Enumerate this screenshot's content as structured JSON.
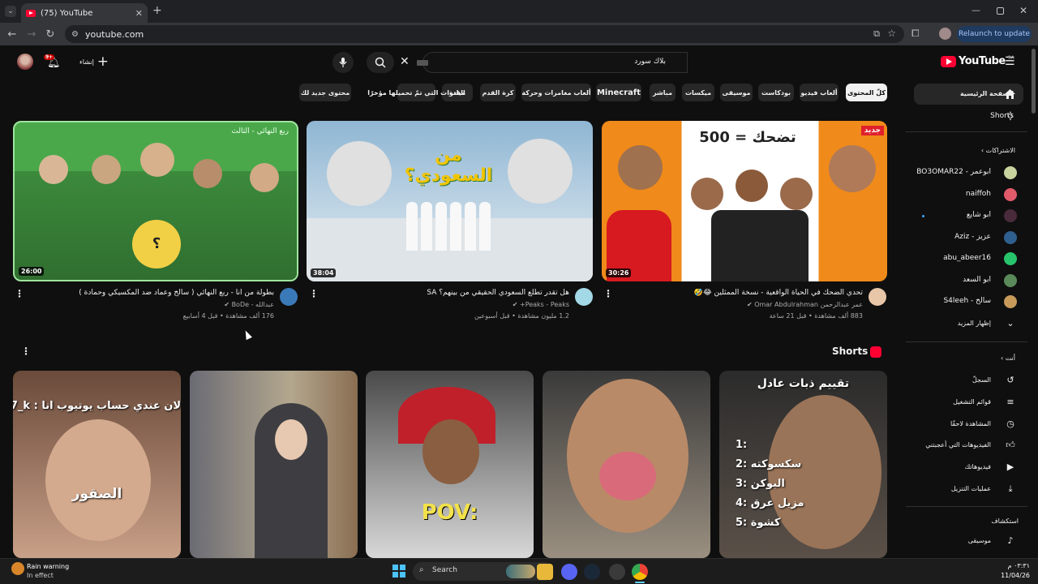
{
  "browser": {
    "tab_title": "(75) YouTube",
    "url": "youtube.com",
    "relaunch_label": "Relaunch to update"
  },
  "header": {
    "logo_text": "YouTube",
    "logo_region": "SA",
    "search_value": "بلاك سورد",
    "create_label": "إنشاء",
    "notif_count": "9+"
  },
  "chips": [
    "كلّ المحتوى",
    "ألعاب فيديو",
    "بودكاست",
    "موسيقى",
    "ميكسات",
    "مباشر",
    "Minecraft",
    "ألعاب مغامرات وحركة",
    "كرة القدم",
    "ميادة",
    "القنوات التي تمّ تحميلها مؤخرًا",
    "محتوى جديد لك"
  ],
  "videos": [
    {
      "title": "بطولة من انا - ربع النهائي ( سالخ وعماد ضد المكسيكي وحمادة )",
      "channel": "عبدالله - BoDe",
      "meta": "176 ألف مشاهدة • قبل 4 أسابيع",
      "duration": "26:00",
      "overlay": "ربع النهائي - الثالث"
    },
    {
      "title": "هل تقدر تطلع السعودي الحقيقي من بينهم؟ SA",
      "channel": "Peaks - Peaks+",
      "meta": "1.2 مليون مشاهدة • قبل أسبوعين",
      "duration": "38:04",
      "overlay": "من السعودي؟"
    },
    {
      "title": "تحدي الضحك في الحياة الواقعية - نسخة الممثلين 😂🤣",
      "channel": "عمر عبدالرحمن Omar Abdulrahman",
      "meta": "883 ألف مشاهدة • قبل 21 ساعة",
      "duration": "30:26",
      "overlay": "تضحك = 500",
      "badge": "جديد"
    }
  ],
  "shorts": {
    "label": "Shorts",
    "items": [
      {
        "caption_top": "لان عندي حساب يوتيوب انا : Q7_k",
        "caption_mid": "الصقور"
      },
      {
        "caption_top": "",
        "caption_mid": ""
      },
      {
        "caption_top": "",
        "caption_mid": "POV:"
      },
      {
        "caption_top": "",
        "caption_mid": ""
      },
      {
        "caption_top": "تقييم ذبات عادل",
        "list": [
          "1:",
          "2: سكسوكته",
          "3: البوكن",
          "4: مزيل عرق",
          "5: كشوة"
        ]
      }
    ]
  },
  "sidebar": {
    "main": [
      {
        "label": "الصفحة الرئيسية",
        "icon": "home-icon"
      },
      {
        "label": "Shorts",
        "icon": "shorts-icon"
      }
    ],
    "subs_header": "الاشتراكات",
    "subs": [
      {
        "label": "ابوعمر - BO3OMAR22",
        "color": "#c8d39e"
      },
      {
        "label": "naiffoh",
        "color": "#e05a6a"
      },
      {
        "label": "ابو شايع",
        "color": "#4a2b3b"
      },
      {
        "label": "عزيز - Aziz",
        "color": "#2f5f8f"
      },
      {
        "label": "abu_abeer16",
        "color": "#27c46b"
      },
      {
        "label": "ابو السعد",
        "color": "#5a8a5a"
      },
      {
        "label": "سالخ - S4leeh",
        "color": "#c89a5a"
      }
    ],
    "show_more": "إظهار المزيد",
    "you_header": "أنت",
    "you": [
      {
        "label": "السجلّ",
        "icon": "history-icon"
      },
      {
        "label": "قوائم التشغيل",
        "icon": "playlist-icon"
      },
      {
        "label": "المشاهدة لاحقًا",
        "icon": "clock-icon"
      },
      {
        "label": "الفيديوهات التي أعجبتني",
        "icon": "like-icon"
      },
      {
        "label": "فيديوهاتك",
        "icon": "video-icon"
      },
      {
        "label": "عمليات التنزيل",
        "icon": "download-icon"
      }
    ],
    "explore_header": "استكشاف",
    "explore": [
      {
        "label": "موسيقى",
        "icon": "music-icon"
      }
    ]
  },
  "taskbar": {
    "weather_title": "Rain warning",
    "weather_sub": "In effect",
    "search_label": "Search",
    "time": "٠٣:٣١ م",
    "date": "11/04/26"
  }
}
